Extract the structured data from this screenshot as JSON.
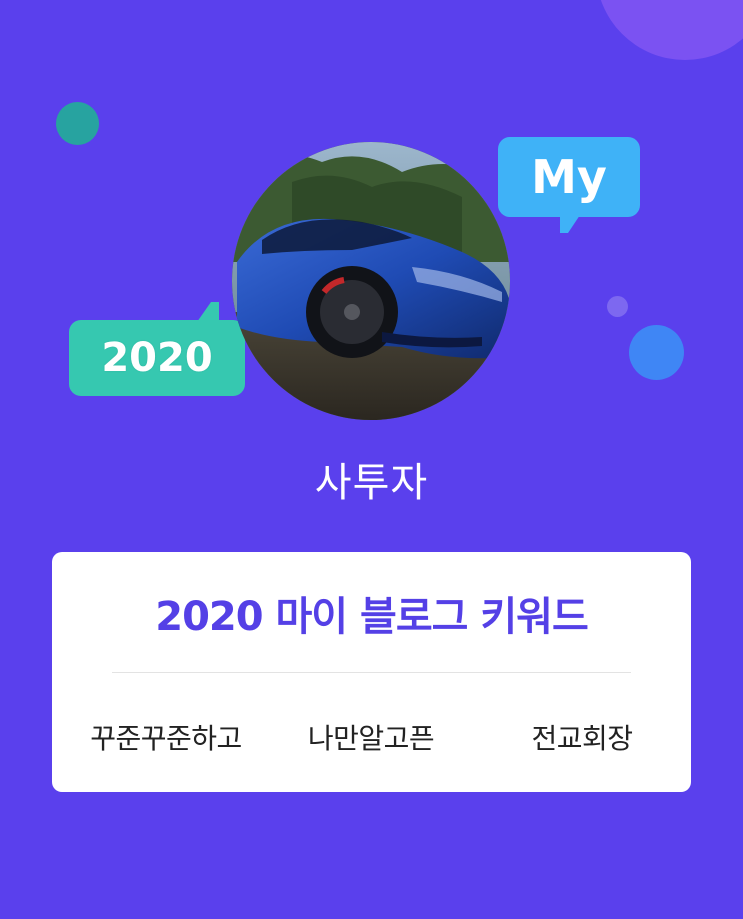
{
  "decorations": {
    "bubble_2020_text": "2020",
    "bubble_my_text": "My",
    "bubble_2020_color": "#36c8b0",
    "bubble_my_color": "#3fb2f7",
    "background_color": "#5a40ed"
  },
  "profile": {
    "nickname": "사투자",
    "avatar": "blue-sports-car-photo"
  },
  "keyword_card": {
    "title": "2020 마이 블로그 키워드",
    "title_color": "#5440e6",
    "keywords": [
      "꾸준꾸준하고",
      "나만알고픈",
      "전교회장"
    ]
  }
}
